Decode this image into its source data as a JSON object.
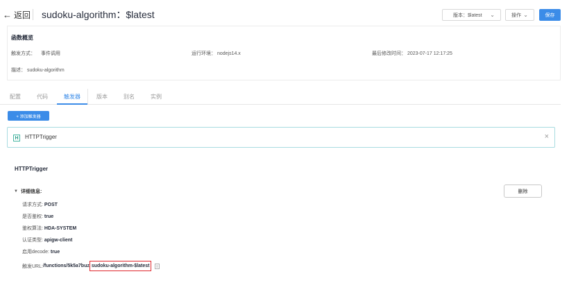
{
  "header": {
    "back_label": "返回",
    "title": "sudoku-algorithm：$latest",
    "version_select": "版本：$latest",
    "ops_select": "操作",
    "save_label": "保存"
  },
  "overview": {
    "title": "函数概览",
    "trigger_mode_label": "触发方式：",
    "trigger_mode_value": "事件调用",
    "runtime_label": "运行环境：",
    "runtime_value": "nodejs14.x",
    "modified_label": "最后修改时间：",
    "modified_value": "2023-07-17 12:17:25",
    "desc_label": "描述：",
    "desc_value": "sudoku-algorithm"
  },
  "tabs": [
    {
      "label": "配置"
    },
    {
      "label": "代码"
    },
    {
      "label": "触发器"
    },
    {
      "label": "版本"
    },
    {
      "label": "别名"
    },
    {
      "label": "实例"
    }
  ],
  "active_tab": "触发器",
  "add_trigger_label": "+ 添加触发器",
  "trigger_card": {
    "icon_letter": "H",
    "name": "HTTPTrigger"
  },
  "detail": {
    "title": "HTTPTrigger",
    "toggle_label": "详细信息:",
    "delete_label": "删除",
    "method_label": "请求方式: ",
    "method_value": "POST",
    "auth_label": "是否鉴权: ",
    "auth_value": "true",
    "algo_label": "鉴权算法: ",
    "algo_value": "HDA-SYSTEM",
    "auth_type_label": "认证类型: ",
    "auth_type_value": "apigw-client",
    "decode_label": "启用decode: ",
    "decode_value": "true",
    "url_label": "触发URL: ",
    "url_prefix": "/functions/5k5a7buz",
    "url_highlight": "sudoku-algorithm-$latest"
  },
  "colors": {
    "accent": "#3b8ce8",
    "highlight_border": "#e0282e",
    "trigger_card_border": "#a8dce0"
  }
}
